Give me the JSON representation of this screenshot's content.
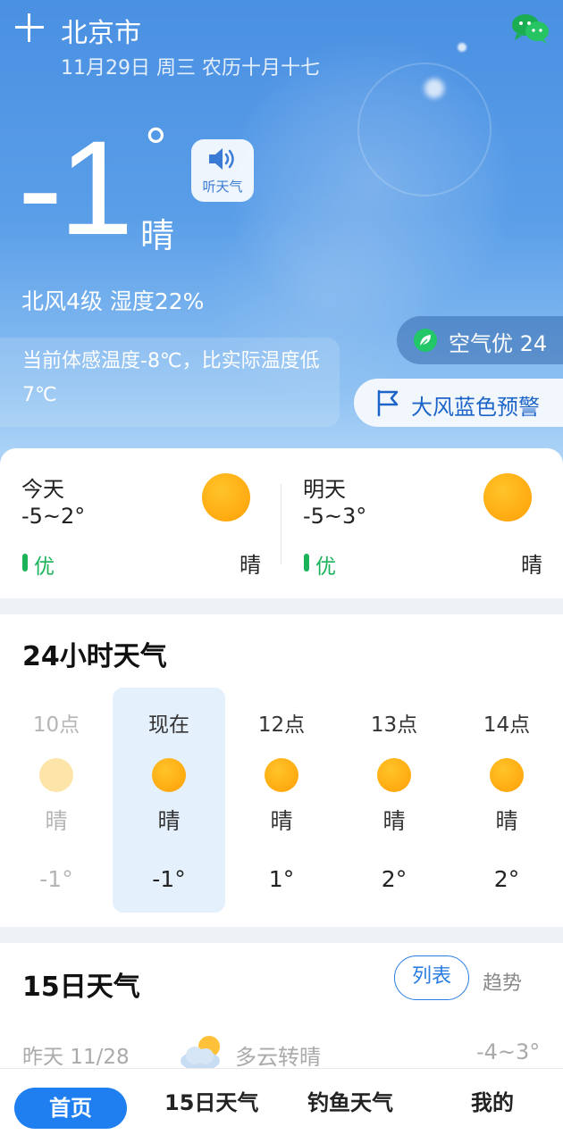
{
  "header": {
    "city": "北京市",
    "date": "11月29日 周三 农历十月十七"
  },
  "current": {
    "temp": "-1",
    "degree_symbol": "°",
    "condition": "晴",
    "listen_label": "听天气",
    "wind_humidity": "北风4级 湿度22%",
    "feels_like": "当前体感温度-8℃，比实际温度低7℃",
    "aqi": "空气优 24",
    "warning": "大风蓝色预警"
  },
  "days": [
    {
      "name": "今天",
      "range": "-5~2°",
      "aq": "优",
      "condition": "晴",
      "icon": "sun-icon"
    },
    {
      "name": "明天",
      "range": "-5~3°",
      "aq": "优",
      "condition": "晴",
      "icon": "sun-icon"
    }
  ],
  "hourly": {
    "title": "24小时天气",
    "items": [
      {
        "time": "10点",
        "condition": "晴",
        "temp": "-1°",
        "icon": "sun-icon",
        "state": "past"
      },
      {
        "time": "现在",
        "condition": "晴",
        "temp": "-1°",
        "icon": "sun-icon",
        "state": "now"
      },
      {
        "time": "12点",
        "condition": "晴",
        "temp": "1°",
        "icon": "sun-icon",
        "state": "future"
      },
      {
        "time": "13点",
        "condition": "晴",
        "temp": "2°",
        "icon": "sun-icon",
        "state": "future"
      },
      {
        "time": "14点",
        "condition": "晴",
        "temp": "2°",
        "icon": "sun-icon",
        "state": "future"
      }
    ]
  },
  "fifteen_day": {
    "title": "15日天气",
    "list_label": "列表",
    "trend_label": "趋势",
    "rows": [
      {
        "label": "昨天 11/28",
        "condition": "多云转晴",
        "range": "-4~3°",
        "icon": "partly-cloudy-icon"
      }
    ]
  },
  "nav": {
    "items": [
      "首页",
      "15日天气",
      "钓鱼天气",
      "我的"
    ]
  },
  "colors": {
    "accent": "#1f7ef0",
    "air_good": "#1bb35a",
    "sun": "#ffaa10"
  }
}
